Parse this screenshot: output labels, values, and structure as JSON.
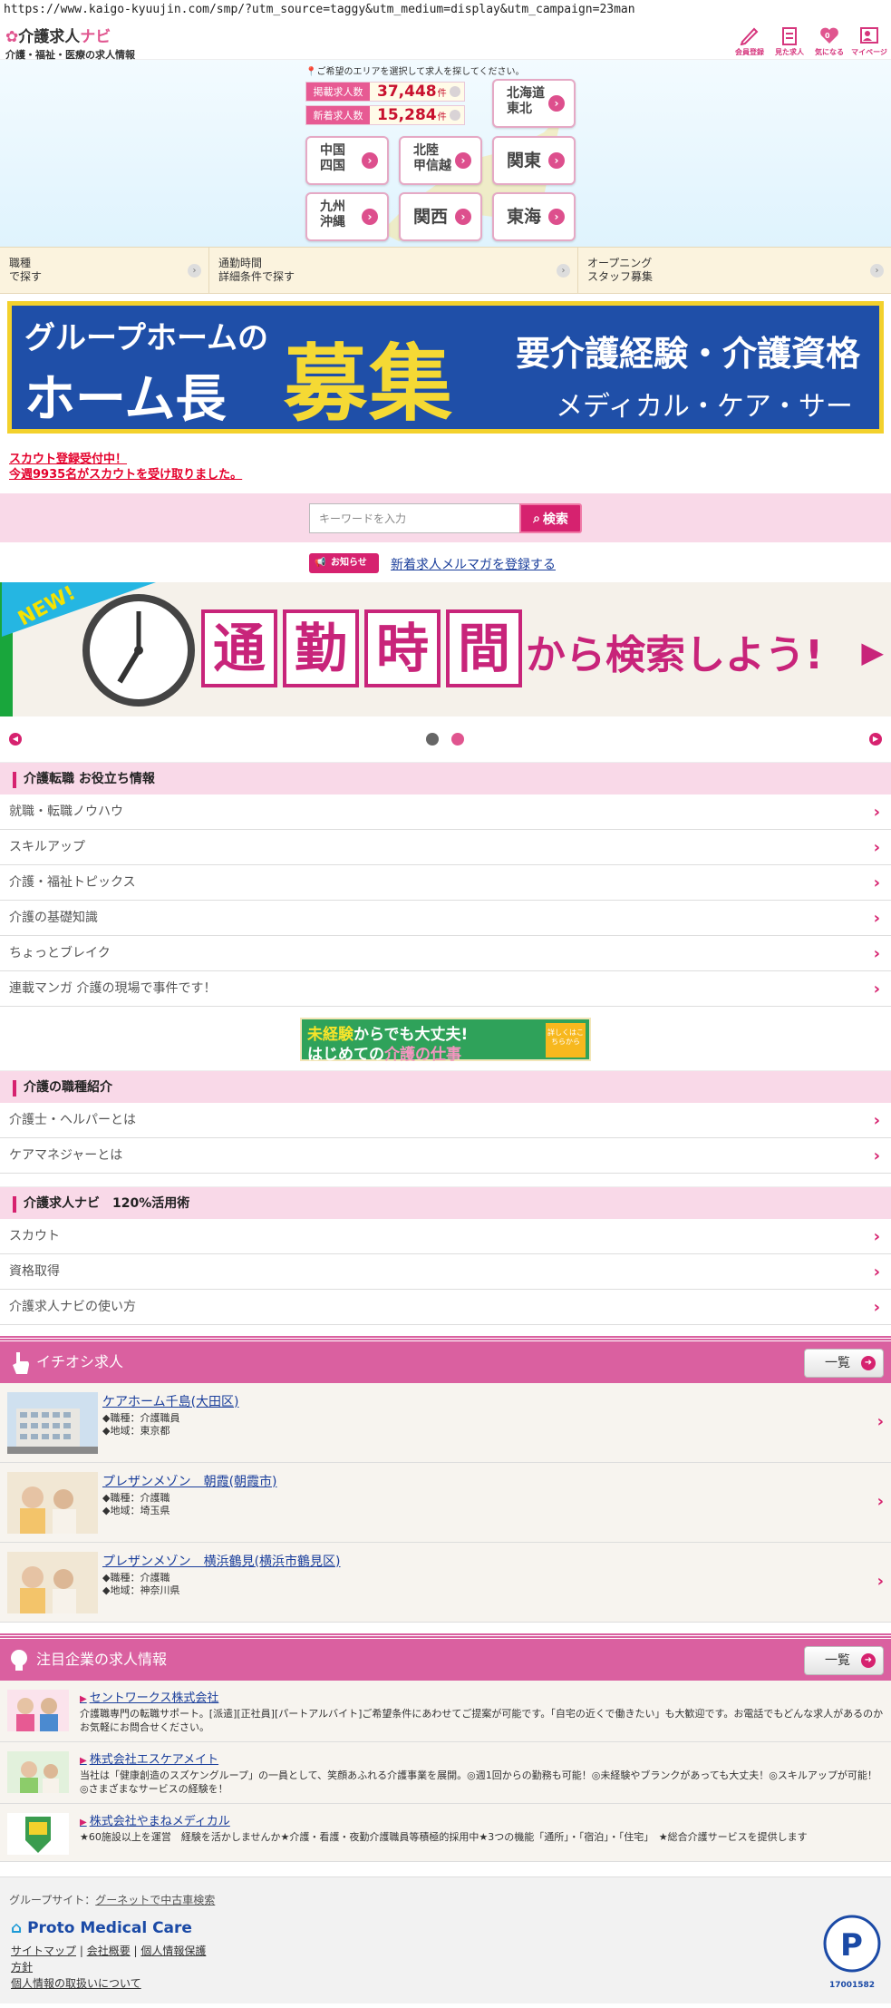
{
  "browser": {
    "url": "https://www.kaigo-kyuujin.com/smp/?utm_source=taggy&utm_medium=display&utm_campaign=23man"
  },
  "header": {
    "logo_title_a": "介護求人",
    "logo_title_b": "ナビ",
    "logo_subtitle": "介護・福祉・医療の求人情報",
    "icons": [
      {
        "label": "会員登録",
        "icon": "pencil-icon"
      },
      {
        "label": "見た求人",
        "icon": "clipboard-icon"
      },
      {
        "label": "気になる",
        "icon": "heart-icon",
        "badge": "0"
      },
      {
        "label": "マイページ",
        "icon": "person-icon"
      }
    ]
  },
  "area": {
    "note": "ご希望のエリアを選択して求人を探してください。",
    "stats": [
      {
        "label": "掲載求人数",
        "value": "37,448",
        "unit": "件"
      },
      {
        "label": "新着求人数",
        "value": "15,284",
        "unit": "件"
      }
    ],
    "regions": {
      "hokkaido": [
        "北海道",
        "東北"
      ],
      "chugoku": [
        "中国",
        "四国"
      ],
      "hokuriku": [
        "北陸",
        "甲信越"
      ],
      "kanto": "関東",
      "kyushu": [
        "九州",
        "沖縄"
      ],
      "kansai": "関西",
      "tokai": "東海"
    }
  },
  "quick": [
    {
      "l1": "職種",
      "l2": "で探す"
    },
    {
      "l1": "通勤時間",
      "l2": "詳細条件で探す"
    },
    {
      "l1": "オープニング",
      "l2": "スタッフ募集"
    }
  ],
  "banner1": {
    "line1": "グループホームの",
    "line2": "ホーム長",
    "big": "募集",
    "right1": "要介護経験・介護資格",
    "right2": "メディカル・ケア・サービス"
  },
  "scout": {
    "line1": "スカウト登録受付中！",
    "line2": "今週9935名がスカウトを受け取りました。"
  },
  "search": {
    "placeholder": "キーワードを入力",
    "button": "検索"
  },
  "news": {
    "badge": "お知らせ",
    "link": "新着求人メルマガを登録する"
  },
  "slider": {
    "tag": "NEW!",
    "kanji": [
      "通",
      "勤",
      "時",
      "間"
    ],
    "tail": "から検索しよう!",
    "arrow": "▶",
    "prev": "◀",
    "next": "▶"
  },
  "sections": {
    "tips": {
      "title": "介護転職 お役立ち情報",
      "items": [
        "就職・転職ノウハウ",
        "スキルアップ",
        "介護・福祉トピックス",
        "介護の基礎知識",
        "ちょっとブレイク",
        "連載マンガ 介護の現場で事件です！"
      ]
    },
    "mini_banner": {
      "t1a": "未経験",
      "t1b": "からでも",
      "t1c": "大丈夫!",
      "t2a": "はじめての",
      "t2b": "介護の仕事",
      "badge": "詳しくはこちらから"
    },
    "jobs_intro": {
      "title": "介護の職種紹介",
      "items": [
        "介護士・ヘルパーとは",
        "ケアマネジャーとは"
      ]
    },
    "navi": {
      "title": "介護求人ナビ　120%活用術",
      "items": [
        "スカウト",
        "資格取得",
        "介護求人ナビの使い方"
      ]
    }
  },
  "pickup": {
    "title": "イチオシ求人",
    "all_button": "一覧",
    "items": [
      {
        "name": "ケアホーム千島(大田区)",
        "job": "◆職種：介護職員",
        "area": "◆地域：東京都"
      },
      {
        "name": "プレザンメゾン　朝霞(朝霞市)",
        "job": "◆職種：介護職",
        "area": "◆地域：埼玉県"
      },
      {
        "name": "プレザンメゾン　横浜鶴見(横浜市鶴見区)",
        "job": "◆職種：介護職",
        "area": "◆地域：神奈川県"
      }
    ]
  },
  "companies": {
    "title": "注目企業の求人情報",
    "all_button": "一覧",
    "items": [
      {
        "name": "セントワークス株式会社",
        "desc": "介護職専門の転職サポート。[派遣][正社員][パートアルバイト]ご希望条件にあわせてご提案が可能です。「自宅の近くで働きたい」も大歓迎です。お電話でもどんな求人があるのかお気軽にお問合せください。"
      },
      {
        "name": "株式会社エスケアメイト",
        "desc": "当社は「健康創造のスズケングループ」の一員として、笑顔あふれる介護事業を展開。◎週1回からの勤務も可能！◎未経験やブランクがあっても大丈夫！◎スキルアップが可能！◎さまざまなサービスの経験を！"
      },
      {
        "name": "株式会社やまねメディカル",
        "desc": "★60施設以上を運営　経験を活かしませんか★介護・看護・夜勤介護職員等積極的採用中★3つの機能「通所」・「宿泊」・「住宅」　★総合介護サービスを提供します"
      }
    ]
  },
  "footer": {
    "group_label": "グループサイト：",
    "group_link": "グーネットで中古車検索",
    "brand": "Proto Medical Care",
    "links": [
      "サイトマップ",
      "会社概要",
      "個人情報保護",
      "方針",
      "個人情報の取扱いについて"
    ],
    "privacy_number": "17001582"
  },
  "colors": {
    "accent": "#d6226f",
    "pink_bg": "#f9d9e8",
    "bar": "#da60a0"
  }
}
